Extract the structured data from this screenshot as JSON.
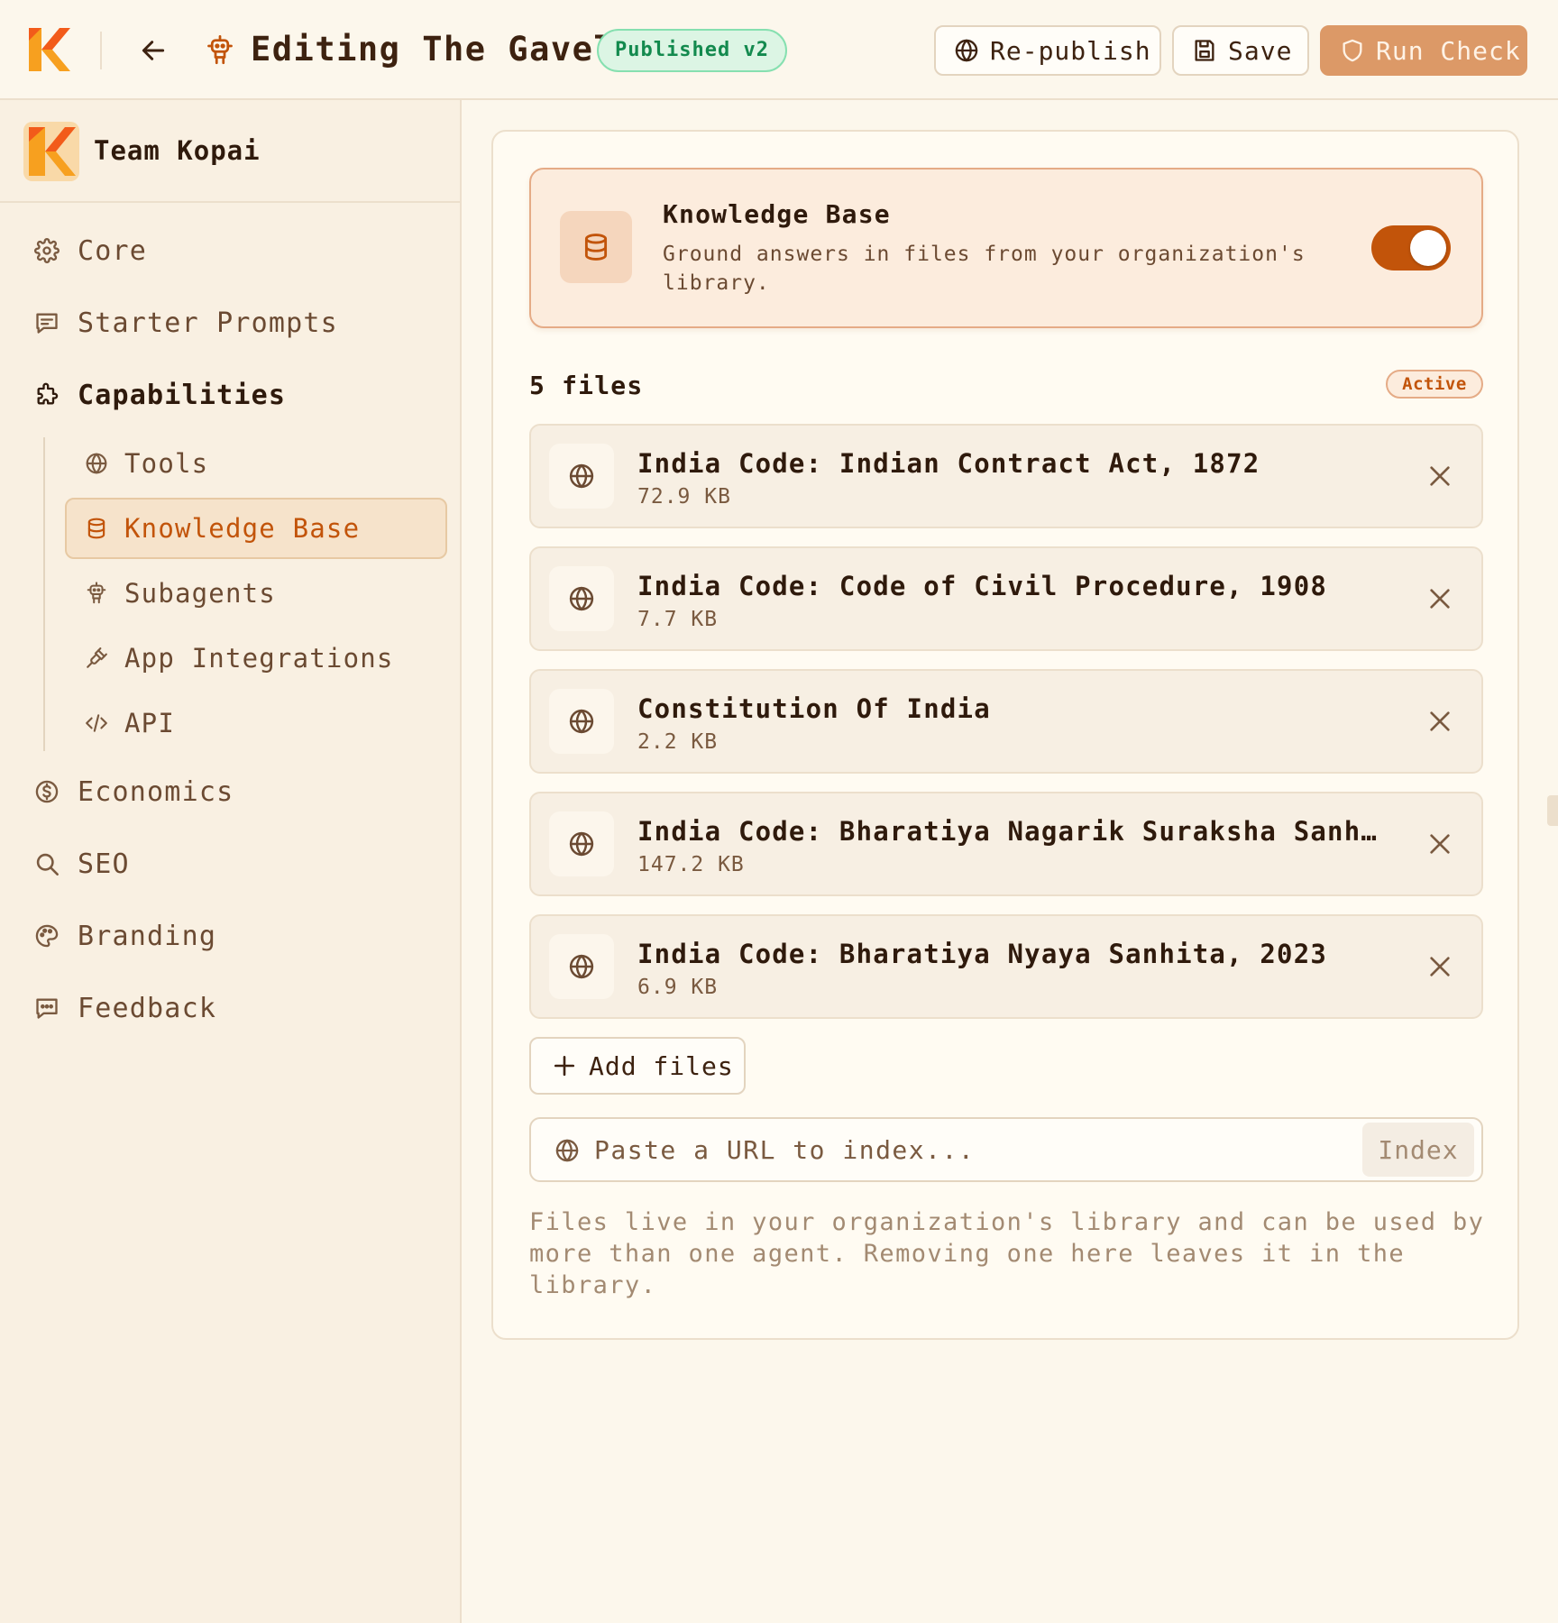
{
  "header": {
    "title": "Editing The Gavel",
    "status_badge": "Published v2",
    "republish_label": "Re-publish",
    "save_label": "Save",
    "run_check_label": "Run Check"
  },
  "sidebar": {
    "team_name": "Team Kopai",
    "items": [
      {
        "label": "Core",
        "icon": "gear-icon"
      },
      {
        "label": "Starter Prompts",
        "icon": "message-square-icon"
      },
      {
        "label": "Capabilities",
        "icon": "puzzle-icon"
      },
      {
        "label": "Economics",
        "icon": "dollar-circle-icon"
      },
      {
        "label": "SEO",
        "icon": "search-icon"
      },
      {
        "label": "Branding",
        "icon": "palette-icon"
      },
      {
        "label": "Feedback",
        "icon": "message-dots-icon"
      }
    ],
    "sub_items": [
      {
        "label": "Tools",
        "icon": "globe-icon"
      },
      {
        "label": "Knowledge Base",
        "icon": "database-icon",
        "active": true
      },
      {
        "label": "Subagents",
        "icon": "robot-icon"
      },
      {
        "label": "App Integrations",
        "icon": "plug-icon"
      },
      {
        "label": "API",
        "icon": "code-icon"
      }
    ]
  },
  "knowledge_base": {
    "title": "Knowledge Base",
    "description": "Ground answers in files from your organization's library.",
    "enabled": true,
    "files_count": "5 files",
    "status": "Active",
    "files": [
      {
        "name": "India Code: Indian Contract Act, 1872",
        "size": "72.9 KB"
      },
      {
        "name": "India Code: Code of Civil Procedure, 1908",
        "size": "7.7 KB"
      },
      {
        "name": "Constitution Of India",
        "size": "2.2 KB"
      },
      {
        "name": "India Code: Bharatiya Nagarik Suraksha Sanhita, …",
        "size": "147.2 KB"
      },
      {
        "name": "India Code: Bharatiya Nyaya Sanhita, 2023",
        "size": "6.9 KB"
      }
    ],
    "add_files_label": "Add files",
    "url_placeholder": "Paste a URL to index...",
    "url_value": "",
    "index_label": "Index",
    "footnote": "Files live in your organization's library and can be used by more than one agent. Removing one here leaves it in the library."
  },
  "colors": {
    "accent": "#c2540a",
    "run_check_bg": "#dc9967",
    "published_bg": "#dcf5e4",
    "published_text": "#138a4e",
    "background": "#fcf7ec"
  }
}
